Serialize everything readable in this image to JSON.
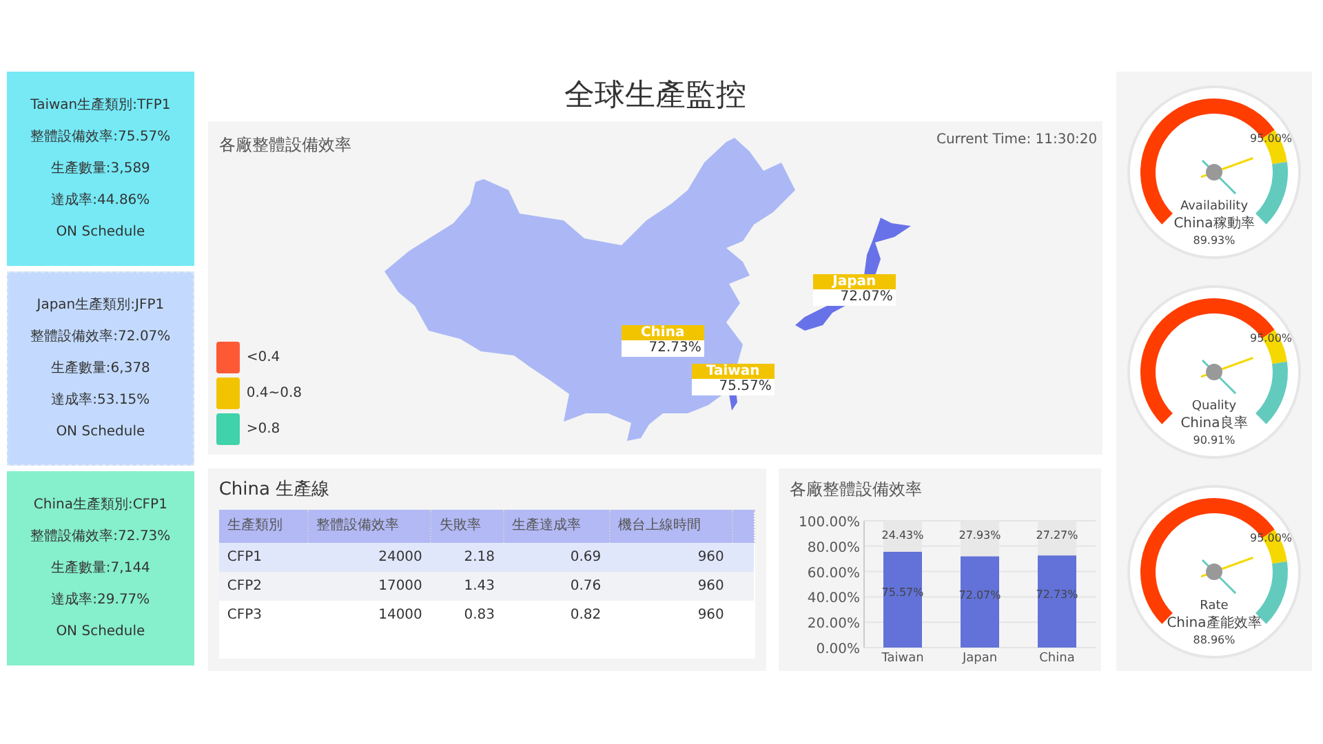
{
  "title": "全球生產監控",
  "sites": [
    {
      "color": "#76e9f5",
      "lines": [
        "Taiwan生產類別:TFP1",
        "整體設備效率:75.57%",
        "生產數量:3,589",
        "達成率:44.86%",
        "ON Schedule"
      ]
    },
    {
      "color": "#c3dafe",
      "lines": [
        "Japan生產類別:JFP1",
        "整體設備效率:72.07%",
        "生產數量:6,378",
        "達成率:53.15%",
        "ON Schedule"
      ]
    },
    {
      "color": "#86efcc",
      "lines": [
        "China生產類別:CFP1",
        "整體設備效率:72.73%",
        "生產數量:7,144",
        "達成率:29.77%",
        "ON Schedule"
      ]
    }
  ],
  "map": {
    "title": "各廠整體設備效率",
    "current_time": "Current Time: 11:30:20",
    "regions": [
      {
        "name": "China",
        "value": "72.73%"
      },
      {
        "name": "Taiwan",
        "value": "75.57%"
      },
      {
        "name": "Japan",
        "value": "72.07%"
      }
    ],
    "legend": [
      {
        "label": "<0.4",
        "color": "#fd5935"
      },
      {
        "label": "0.4~0.8",
        "color": "#f2c400"
      },
      {
        "label": ">0.8",
        "color": "#40d2aa"
      }
    ]
  },
  "table": {
    "title": "China 生產線",
    "columns": [
      "生產類別",
      "整體設備效率",
      "失敗率",
      "生產達成率",
      "機台上線時間"
    ],
    "rows": [
      {
        "cells": [
          "CFP1",
          "24000",
          "2.18",
          "0.69",
          "960"
        ],
        "selected": true
      },
      {
        "cells": [
          "CFP2",
          "17000",
          "1.43",
          "0.76",
          "960"
        ],
        "selected": false
      },
      {
        "cells": [
          "CFP3",
          "14000",
          "0.83",
          "0.82",
          "960"
        ],
        "selected": false
      }
    ]
  },
  "bar_panel": {
    "title": "各廠整體設備效率",
    "chart_data": {
      "type": "bar",
      "stacked": true,
      "grid": true,
      "categories": [
        "Taiwan",
        "Japan",
        "China"
      ],
      "series": [
        {
          "color": "#6272d8",
          "values": [
            75.57,
            72.07,
            72.73
          ]
        },
        {
          "color": "#e8e8e8",
          "values": [
            24.43,
            27.93,
            27.27
          ]
        }
      ],
      "ylim": [
        0,
        100
      ],
      "yticks": [
        {
          "value": 0,
          "label": "0.00%"
        },
        {
          "value": 20,
          "label": "20.00%"
        },
        {
          "value": 40,
          "label": "40.00%"
        },
        {
          "value": 60,
          "label": "60.00%"
        },
        {
          "value": 80,
          "label": "80.00%"
        },
        {
          "value": 100,
          "label": "100.00%"
        }
      ],
      "value_labels": [
        "75.57%",
        "72.07%",
        "72.73%",
        "24.43%",
        "27.93%",
        "27.27%"
      ]
    }
  },
  "gauges": [
    {
      "name": "Availability",
      "subtitle": "China稼動率",
      "value": "89.93%",
      "target": "95.00%"
    },
    {
      "name": "Quality",
      "subtitle": "China良率",
      "value": "90.91%",
      "target": "95.00%"
    },
    {
      "name": "Rate",
      "subtitle": "China產能效率",
      "value": "88.96%",
      "target": "95.00%"
    }
  ]
}
